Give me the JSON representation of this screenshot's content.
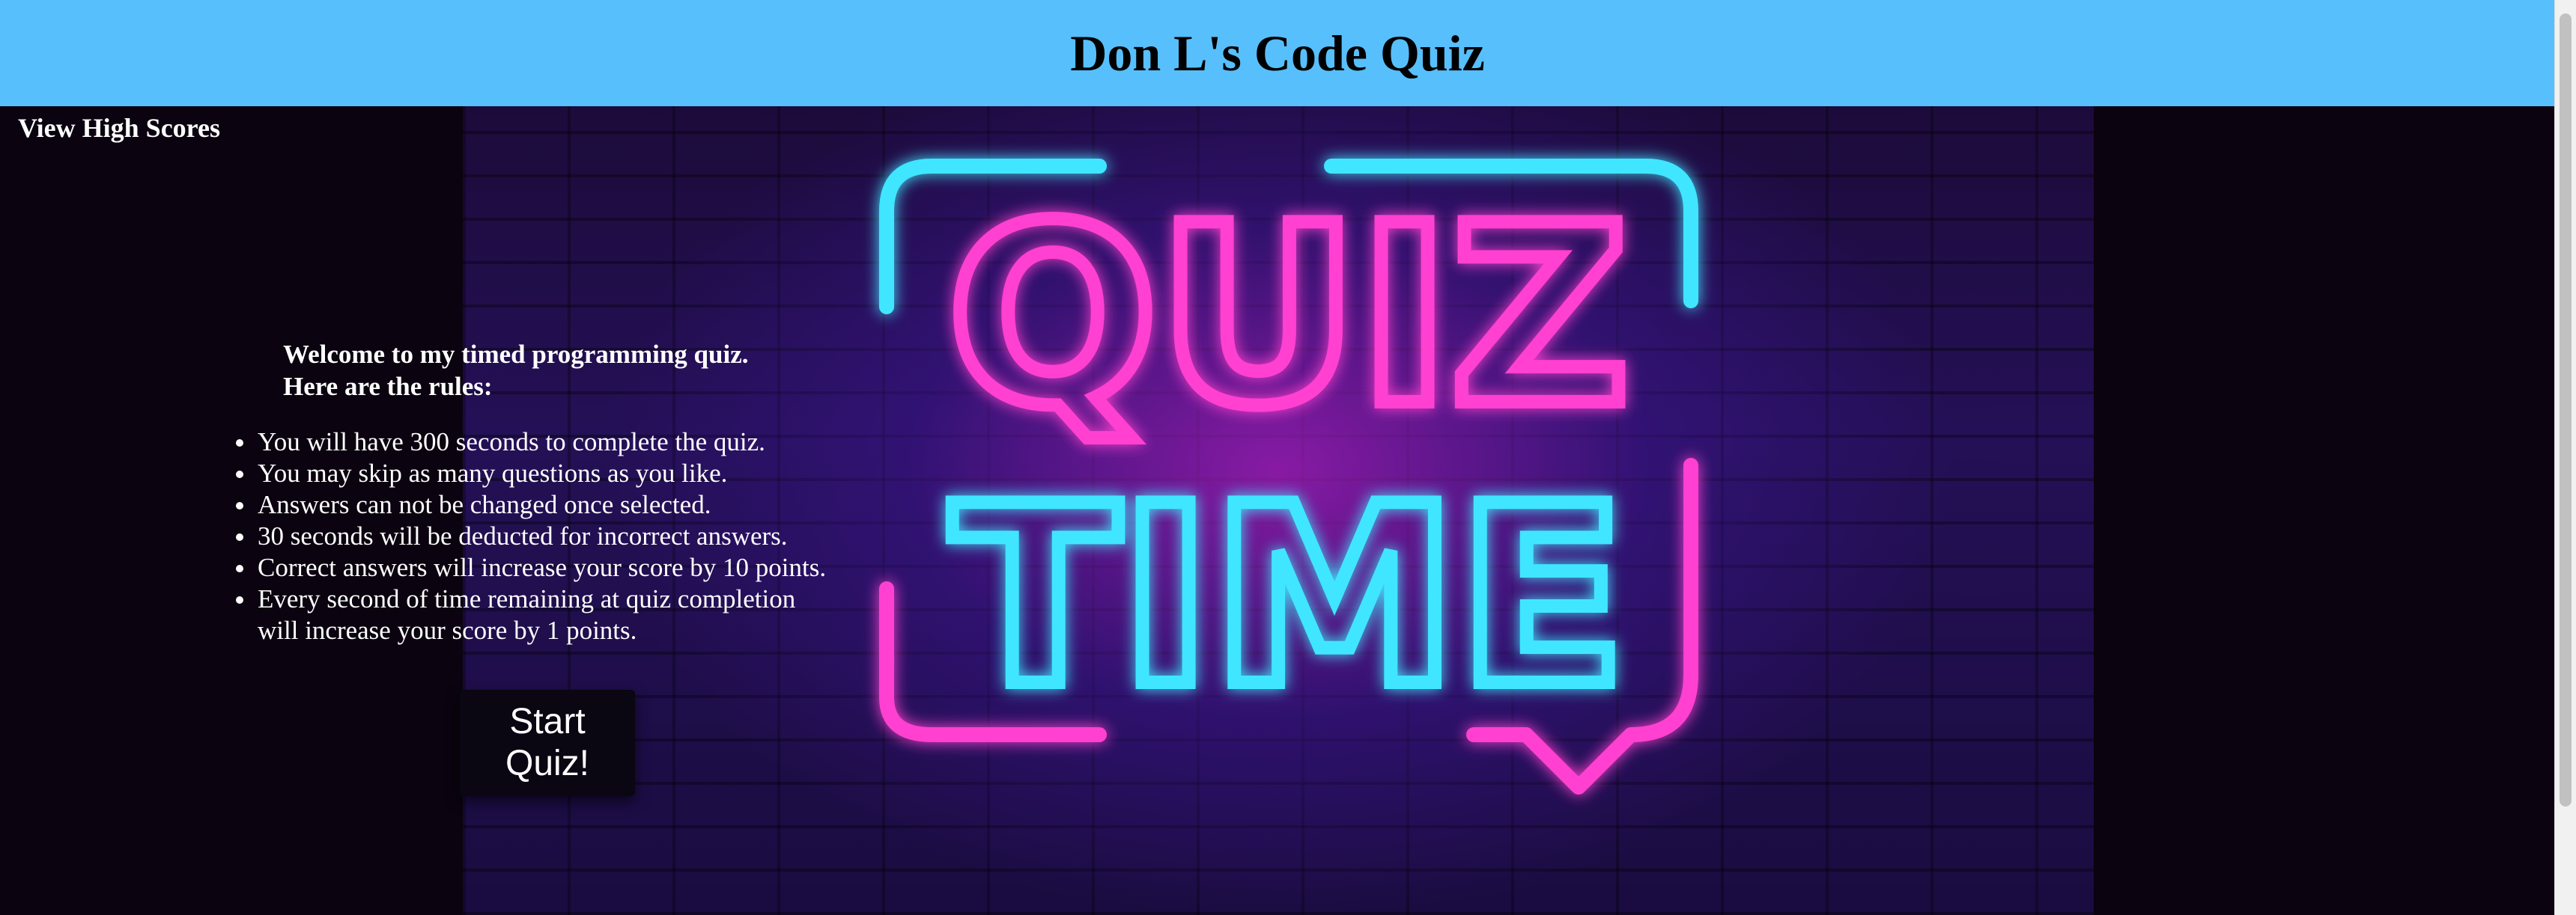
{
  "header": {
    "title": "Don L's Code Quiz",
    "background_color": "#57bffb"
  },
  "nav": {
    "high_scores_label": "View High Scores"
  },
  "intro": {
    "welcome_line1": "Welcome to my timed programming quiz.",
    "welcome_line2": "Here are the rules:"
  },
  "rules": [
    "You will have 300 seconds to complete the quiz.",
    "You may skip as many questions as you like.",
    "Answers can not be changed once selected.",
    "30 seconds will be deducted for incorrect answers.",
    "Correct answers will increase your score by 10 points.",
    "Every second of time remaining at quiz completion will increase your score by 1 points."
  ],
  "start_button": {
    "label": "Start Quiz!"
  },
  "artwork": {
    "word1": "QUIZ",
    "word2": "TIME",
    "neon_pink": "#ff3fd0",
    "neon_cyan": "#3fe6ff"
  }
}
